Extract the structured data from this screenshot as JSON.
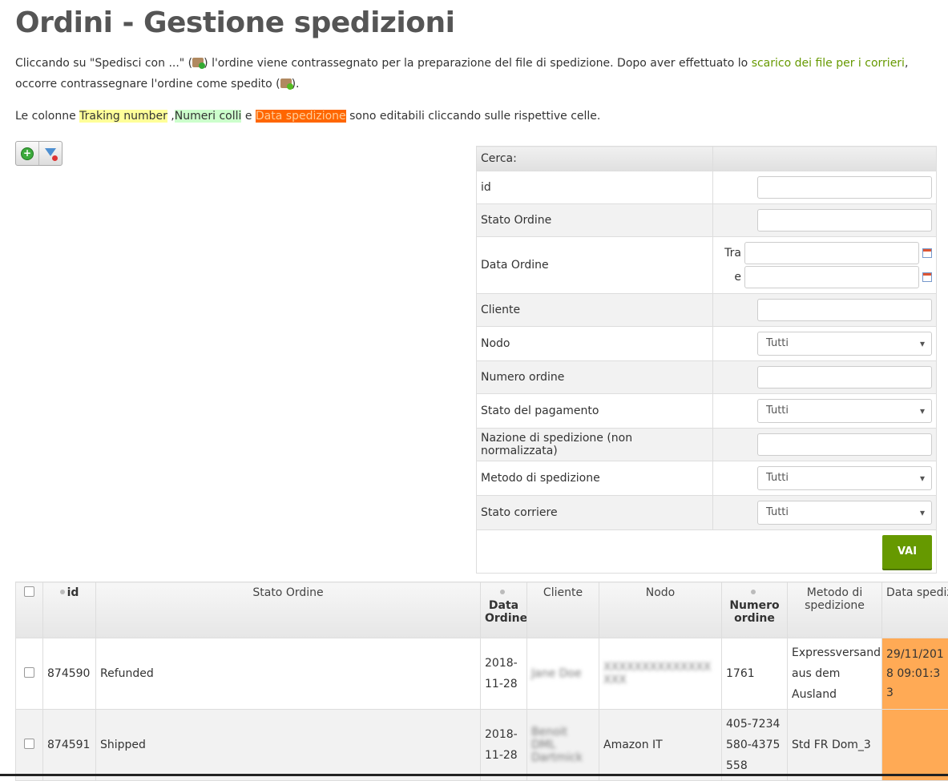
{
  "title": "Ordini - Gestione spedizioni",
  "intro": {
    "p1": "Cliccando su \"Spedisci con ...\" (",
    "p2": ") l'ordine viene contrassegnato per la preparazione del file di spedizione. Dopo aver effettuato lo ",
    "link": "scarico dei file per i corrieri",
    "p3": ", occorre contrassegnare l'ordine come spedito (",
    "p4": ")."
  },
  "intro2": {
    "p1": "Le colonne ",
    "traking": "Traking number",
    "sep1": " ,",
    "colli": "Numeri colli",
    "sep2": " e ",
    "data": "Data spedizione",
    "p2": " sono editabili cliccando sulle rispettive celle."
  },
  "search": {
    "header": "Cerca:",
    "fields": {
      "id": "id",
      "stato_ordine": "Stato Ordine",
      "data_ordine": "Data Ordine",
      "tra": "Tra",
      "e": "e",
      "cliente": "Cliente",
      "nodo": "Nodo",
      "numero_ordine": "Numero ordine",
      "stato_pagamento": "Stato del pagamento",
      "nazione": "Nazione di spedizione (non normalizzata)",
      "metodo": "Metodo di spedizione",
      "stato_corriere": "Stato corriere"
    },
    "select_default": "Tutti",
    "submit": "VAI"
  },
  "orders": {
    "columns": [
      "id",
      "Stato Ordine",
      "Data Ordine",
      "Cliente",
      "Nodo",
      "Numero ordine",
      "Metodo di spedizione",
      "Data spedizione"
    ],
    "rows": [
      {
        "id": "874590",
        "stato": "Refunded",
        "data_ordine": "2018-11-28",
        "cliente": "Jane Doe",
        "nodo": "XXXXXXXXXXXXXXXXX",
        "numero": "1761",
        "metodo": "Expressversand aus dem Ausland",
        "data_spedizione": "29/11/2018 09:01:33"
      },
      {
        "id": "874591",
        "stato": "Shipped",
        "data_ordine": "2018-11-28",
        "cliente": "Benoit DML Dartmick",
        "nodo": "Amazon IT",
        "numero": "405-7234580-4375558",
        "metodo": "Std FR Dom_3",
        "data_spedizione": ""
      }
    ]
  }
}
